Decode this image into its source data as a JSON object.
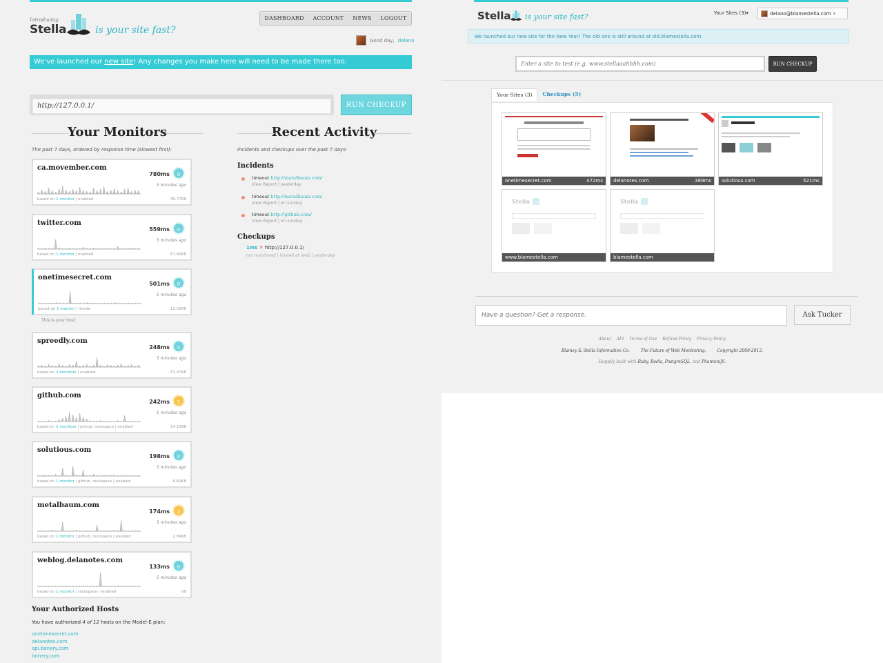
{
  "left": {
    "intro": "Introducing",
    "brand": "Stella",
    "tagline": "is your site fast?",
    "nav": [
      "DASHBOARD",
      "ACCOUNT",
      "NEWS",
      "LOGOUT"
    ],
    "greeting": "Good day,",
    "username": "delano",
    "banner": {
      "pre": "We've launched our ",
      "link": "new site",
      "post": "! Any changes you make here will need to be made there too."
    },
    "url_value": "http://127.0.0.1/",
    "run_label": "RUN CHECKUP",
    "monitors_title": "Your Monitors",
    "monitors_note": "The past 7 days, ordered by response time (slowest first):",
    "activity_title": "Recent Activity",
    "activity_note": "Incidents and checkups over the past 7 days:",
    "incidents_title": "Incidents",
    "checkups_title": "Checkups",
    "monitors": [
      {
        "host": "ca.movember.com",
        "ms": "780ms",
        "count": "0",
        "ago": "5 minutes ago",
        "meta_pre": "based on ",
        "meta_link": "1 monitor",
        "meta_post": " | enabled",
        "size": "35.77KB",
        "warn": false
      },
      {
        "host": "twitter.com",
        "ms": "559ms",
        "count": "0",
        "ago": "5 minutes ago",
        "meta_pre": "based on ",
        "meta_link": "1 monitor",
        "meta_post": " | enabled",
        "size": "67.40KB",
        "warn": false
      },
      {
        "host": "onetimesecret.com",
        "ms": "501ms",
        "count": "0",
        "ago": "5 minutes ago",
        "meta_pre": "based on ",
        "meta_link": "1 monitor",
        "meta_post": " | linode",
        "size": "12.32KB",
        "warn": false
      },
      {
        "host": "spreedly.com",
        "ms": "248ms",
        "count": "0",
        "ago": "5 minutes ago",
        "meta_pre": "based on ",
        "meta_link": "2 monitors",
        "meta_post": " | enabled",
        "size": "51.47KB",
        "warn": false
      },
      {
        "host": "github.com",
        "ms": "242ms",
        "count": "1",
        "ago": "5 minutes ago",
        "meta_pre": "based on ",
        "meta_link": "2 monitors",
        "meta_post": " | github, rackspace | enabled",
        "size": "14.15KB",
        "warn": true
      },
      {
        "host": "solutious.com",
        "ms": "198ms",
        "count": "0",
        "ago": "5 minutes ago",
        "meta_pre": "based on ",
        "meta_link": "1 monitor",
        "meta_post": " | github, rackspace | enabled",
        "size": "6.60KB",
        "warn": false
      },
      {
        "host": "metalbaum.com",
        "ms": "174ms",
        "count": "2",
        "ago": "5 minutes ago",
        "meta_pre": "based on ",
        "meta_link": "1 monitor",
        "meta_post": " | github, rackspace | enabled",
        "size": "2.89KB",
        "warn": true
      },
      {
        "host": "weblog.delanotes.com",
        "ms": "133ms",
        "count": "0",
        "ago": "5 minutes ago",
        "meta_pre": "based on ",
        "meta_link": "1 monitor",
        "meta_post": " | rackspace | enabled",
        "size": "0B",
        "warn": false
      }
    ],
    "host_note": "This is your host.",
    "incidents": [
      {
        "type": "timeout",
        "url": "http://metalbaum.com/",
        "report": "View Report",
        "when": "yesterday"
      },
      {
        "type": "timeout",
        "url": "http://metalbaum.com/",
        "report": "View Report",
        "when": "on sunday"
      },
      {
        "type": "timeout",
        "url": "http://github.com/",
        "report": "View Report",
        "when": "on sunday"
      }
    ],
    "checkup": {
      "ms": "1ms",
      "url": "http://127.0.0.1/",
      "detail": "not monitored | hosted at iweb | yesterday"
    },
    "auth_title": "Your Authorized Hosts",
    "auth_sub_pre": "You have authorized ",
    "auth_sub_em": "4 of 12",
    "auth_sub_post": " hosts on the Model-E plan:",
    "auth_hosts": [
      "onetimesecret.com",
      "delanotes.com",
      "api.bonery.com",
      "bonery.com"
    ]
  },
  "right": {
    "brand": "Stella",
    "tagline": "is your site fast?",
    "sites_menu": "Your Sites (3)",
    "user_email": "delano@blamestella.com",
    "notice": "We launched our new site for the New Year! The old one is still around at old.blamestella.com.",
    "search_placeholder": "Enter a site to test (e.g. www.stellaaahhhh.com)",
    "run_label": "RUN CHECKUP",
    "tab_sites": "Your Sites  (3)",
    "tab_checkups": "Checkups  (5)",
    "thumbs": [
      {
        "name": "onetimesecret.com",
        "ms": "472ms"
      },
      {
        "name": "delanotes.com",
        "ms": "389ms"
      },
      {
        "name": "solutious.com",
        "ms": "521ms"
      },
      {
        "name": "www.blamestella.com",
        "ms": ""
      },
      {
        "name": "blamestella.com",
        "ms": ""
      }
    ],
    "question_placeholder": "Have a question? Get a response.",
    "ask_label": "Ask Tucker",
    "footer_links": [
      "About",
      "API",
      "Terms of Use",
      "Refund Policy",
      "Privacy Policy"
    ],
    "footer_line2": [
      "Blamey & Stella Information Co.",
      "The Future of Web Monitoring.",
      "Copyright 2008-2013."
    ],
    "footer_line3_pre": "Happily built with ",
    "footer_line3_tech": "Ruby, Redis, PostgreSQL",
    "footer_line3_and": ", and ",
    "footer_line3_last": "PhantomJS",
    "footer_line3_end": "."
  },
  "colors": {
    "accent": "#34cbd5",
    "link": "#2bb5c4",
    "warn": "#f8c54c",
    "incident": "#f08c7a"
  }
}
